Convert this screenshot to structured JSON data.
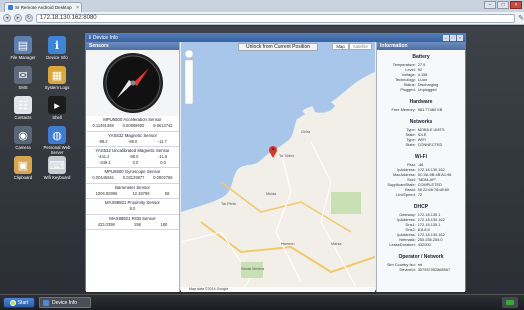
{
  "browser": {
    "tab_title": "SI Remote Android Desktop",
    "tab_close": "×",
    "url": "172.18.130.162:8080",
    "win_min": "–",
    "win_max": "□",
    "win_close": "×"
  },
  "desktop_icons": [
    {
      "label": "File Manager",
      "icon": "folder-icon",
      "color": "#5c7fb0",
      "glyph": "▤"
    },
    {
      "label": "Device Info",
      "icon": "device-info-icon",
      "color": "#3e86d3",
      "glyph": "ℹ"
    },
    {
      "label": "SMS",
      "icon": "sms-icon",
      "color": "#5f6b7c",
      "glyph": "✉"
    },
    {
      "label": "System Logs",
      "icon": "system-logs-icon",
      "color": "#d9a73b",
      "glyph": "▦"
    },
    {
      "label": "Contacts",
      "icon": "contacts-icon",
      "color": "#e2e5ea",
      "glyph": "☷"
    },
    {
      "label": "Shell",
      "icon": "shell-icon",
      "color": "#1c1c1c",
      "glyph": "▸"
    },
    {
      "label": "Camera",
      "icon": "camera-icon",
      "color": "#5b6675",
      "glyph": "◉"
    },
    {
      "label": "Personal Web Server",
      "icon": "web-server-icon",
      "color": "#3d7cd1",
      "glyph": "◍"
    },
    {
      "label": "Clipboard",
      "icon": "clipboard-icon",
      "color": "#d8a651",
      "glyph": "▣"
    },
    {
      "label": "Wifi Keyboard",
      "icon": "keyboard-icon",
      "color": "#c8cdd4",
      "glyph": "⌨"
    }
  ],
  "device_window": {
    "title": "Device Info",
    "sensors_title": "Sensors",
    "info_title": "Information",
    "map": {
      "unlock_label": "Unlock from Current Position",
      "type_map": "Map",
      "type_satellite": "Satellite",
      "footer": "Map data ©2014 Google",
      "labels": [
        "Gżira",
        "Ta' Xbiex",
        "Tal-Pietà",
        "Msida",
        "Marsa",
        "Ħamrun",
        "Santa Venera"
      ]
    },
    "sensors": [
      {
        "name": "MPU6500 Acceleration Sensor",
        "values": [
          "0.11491368",
          "0.50889600",
          "9.6613742"
        ]
      },
      {
        "name": "YAS532 Magnetic Sensor",
        "values": [
          "-98.2",
          "-88.0",
          "-11.7"
        ]
      },
      {
        "name": "YAS532 Uncalibrated Magnetic Sensor",
        "values": [
          "-441.2",
          "-88.0",
          "-11.6",
          "-349.1",
          "0.0",
          "0.0"
        ]
      },
      {
        "name": "MPU6500 Gyroscope Sensor",
        "values": [
          "0.00445661",
          "0.03129877",
          "0.0002765"
        ]
      },
      {
        "name": "Barometer Sensor",
        "values": [
          "1006.82996",
          "12.38799",
          "58"
        ]
      },
      {
        "name": "MAX88921 Proximity Sensor",
        "values": [
          "8.0"
        ]
      },
      {
        "name": "MAX88921 RGB Sensor",
        "values": [
          "423.0398",
          "258",
          "180"
        ]
      }
    ],
    "info_sections": [
      {
        "title": "Battery",
        "rows": [
          [
            "Temperature:",
            "27.9"
          ],
          [
            "Level:",
            "92"
          ],
          [
            "Voltage:",
            "4.158"
          ],
          [
            "Technology:",
            "Li-ion"
          ],
          [
            "Status:",
            "Discharging"
          ],
          [
            "Plugged:",
            "Unplugged"
          ]
        ]
      },
      {
        "title": "Hardware",
        "rows": [
          [
            "Free Memory:",
            "981.77480 KB"
          ]
        ]
      },
      {
        "title": "Networks",
        "rows": [
          [
            "Type:",
            "MOBILE UMTS"
          ],
          [
            "State:",
            "IDLE"
          ],
          [
            "Type:",
            "WIFI"
          ],
          [
            "State:",
            "CONNECTED"
          ]
        ]
      },
      {
        "title": "Wi-Fi",
        "rows": [
          [
            "Rssi:",
            "-46"
          ],
          [
            "IpAddress:",
            "172.18.130.162"
          ],
          [
            "MacAddress:",
            "5C:0A:5B:4B:A1:96"
          ],
          [
            "Ssid:",
            "\"MDM-AP\""
          ],
          [
            "SupplicantState:",
            "COMPLETED"
          ],
          [
            "Bssid:",
            "00:22:6b:76:d8:60"
          ],
          [
            "LinkSpeed:",
            "72"
          ]
        ]
      },
      {
        "title": "DHCP",
        "rows": [
          [
            "Gateway:",
            "172.18.130.1"
          ],
          [
            "IpAddress:",
            "172.18.130.162"
          ],
          [
            "Dns1:",
            "172.18.130.1"
          ],
          [
            "Dns2:",
            "8.8.8.8"
          ],
          [
            "IpAddress:",
            "172.18.130.162"
          ],
          [
            "Netmask:",
            "255.255.255.0"
          ],
          [
            "LeaseDuration:",
            "432000"
          ]
        ]
      },
      {
        "title": "Operator / Network",
        "rows": [
          [
            "Sim Country Iso:",
            "mt"
          ],
          [
            "DeviceId:",
            "357937052868967"
          ]
        ]
      }
    ]
  },
  "taskbar": {
    "start_label": "Start",
    "task_label": "Device Info"
  }
}
